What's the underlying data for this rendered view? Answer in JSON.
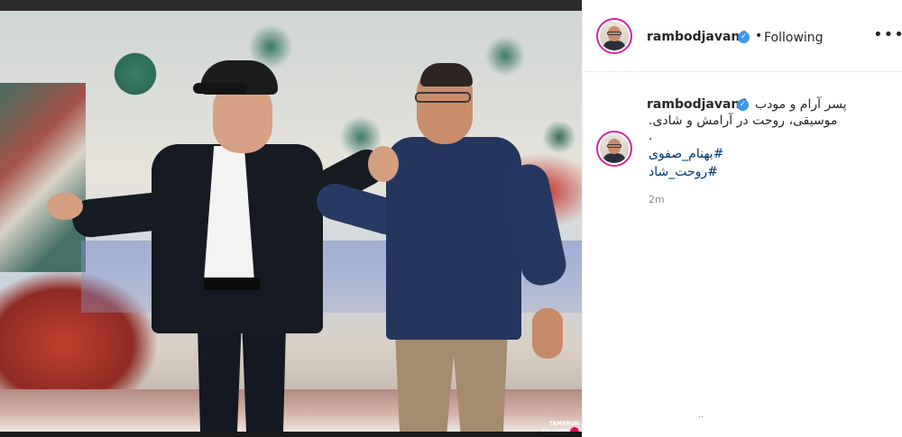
{
  "post": {
    "username": "rambodjavan1",
    "separator": "•",
    "follow_status": "Following",
    "more_label": "•••",
    "caption_lines": [
      "پسر آرام و مودب",
      "موسیقی، روحت در آرامش و شادی."
    ],
    "caption_dot": ".",
    "hashtags": [
      "#بهنام_صفوی",
      "#روحت_شاد"
    ],
    "timestamp": "2m",
    "faint_mark": ".."
  },
  "media": {
    "watermark_line1": "TAMEROH",
    "watermark_line2": "FALAHAT"
  },
  "colors": {
    "link": "#003569",
    "verified": "#3897f0",
    "story_ring": "#d6249f",
    "text": "#262626",
    "muted": "#8e8e8e"
  },
  "icons": {
    "verified": "verified-badge-icon",
    "more": "more-options-icon"
  }
}
